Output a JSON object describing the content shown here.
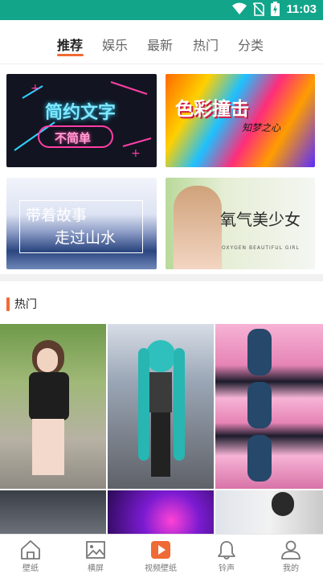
{
  "status_bar": {
    "time": "11:03",
    "icons": [
      "wifi-icon",
      "no-sim-icon",
      "battery-charging-icon"
    ]
  },
  "tabs": [
    {
      "label": "推荐",
      "active": true
    },
    {
      "label": "娱乐",
      "active": false
    },
    {
      "label": "最新",
      "active": false
    },
    {
      "label": "热门",
      "active": false
    },
    {
      "label": "分类",
      "active": false
    }
  ],
  "banners": [
    {
      "line1": "简约文字",
      "line2": "不简单"
    },
    {
      "line1": "色彩撞击",
      "line2": "知梦之心"
    },
    {
      "line1": "带着故事",
      "line2": "走过山水"
    },
    {
      "line1": "氧气美少女",
      "line2": "OXYGEN BEAUTIFUL GIRL"
    }
  ],
  "hot_section": {
    "title": "热门"
  },
  "bottom_nav": [
    {
      "label": "壁纸",
      "icon": "home-icon",
      "active": false
    },
    {
      "label": "横屏",
      "icon": "image-icon",
      "active": false
    },
    {
      "label": "视频壁纸",
      "icon": "video-play-icon",
      "active": true
    },
    {
      "label": "铃声",
      "icon": "bell-icon",
      "active": false
    },
    {
      "label": "我的",
      "icon": "user-icon",
      "active": false
    }
  ],
  "colors": {
    "status_bar": "#12a58a",
    "accent": "#f06a35"
  }
}
